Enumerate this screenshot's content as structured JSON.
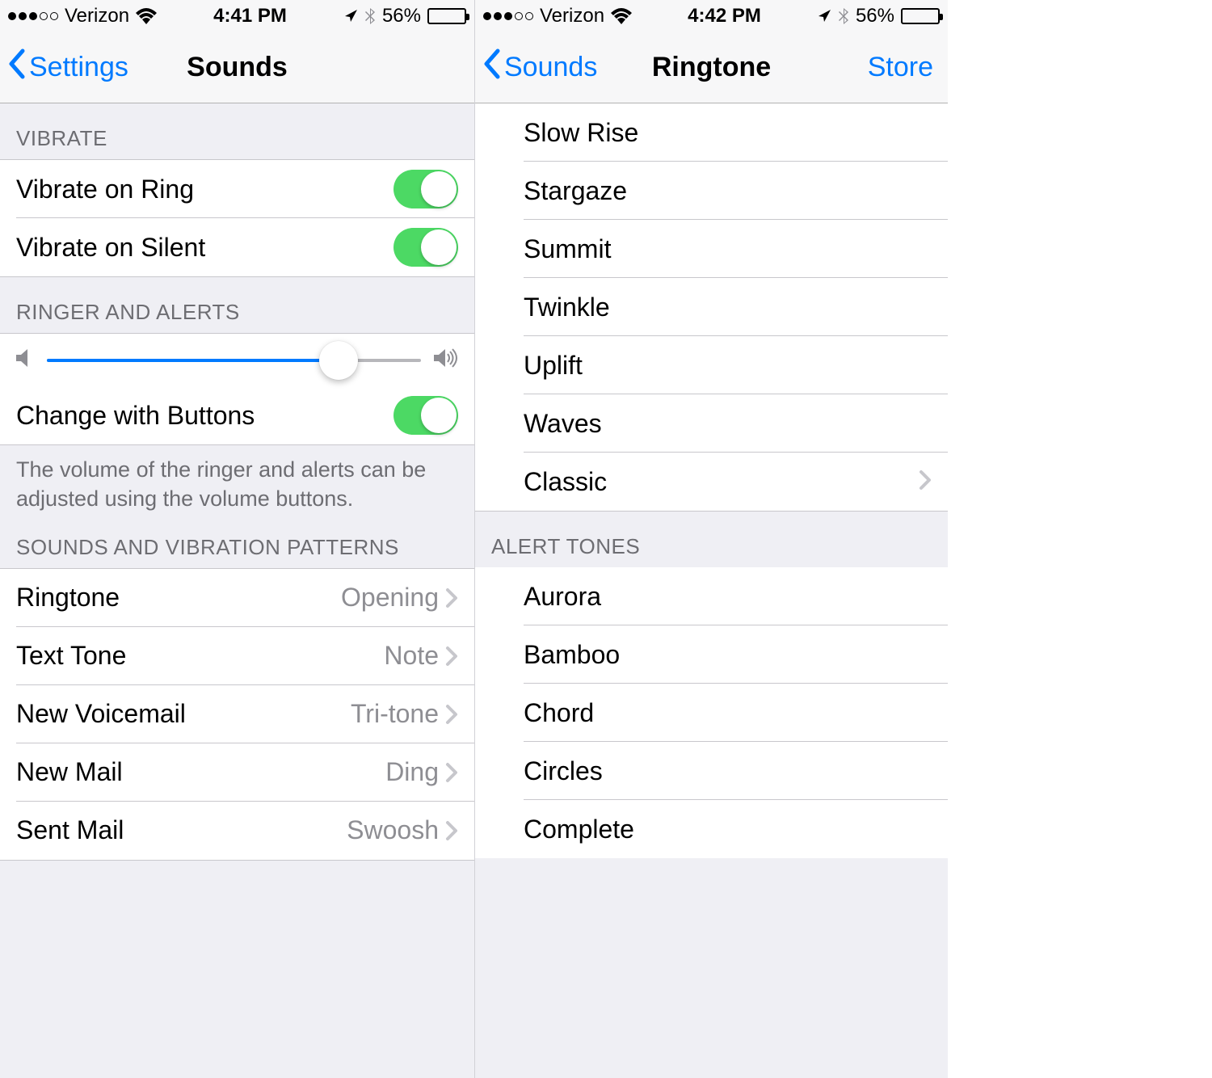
{
  "left": {
    "statusbar": {
      "carrier": "Verizon",
      "time": "4:41 PM",
      "battery_pct": "56%"
    },
    "navbar": {
      "back_label": "Settings",
      "title": "Sounds"
    },
    "sections": {
      "vibrate": {
        "header": "VIBRATE",
        "vibrate_ring": "Vibrate on Ring",
        "vibrate_silent": "Vibrate on Silent"
      },
      "ringer": {
        "header": "RINGER AND ALERTS",
        "change_buttons": "Change with Buttons",
        "footer": "The volume of the ringer and alerts can be adjusted using the volume buttons.",
        "slider_value": 78
      },
      "patterns": {
        "header": "SOUNDS AND VIBRATION PATTERNS",
        "items": [
          {
            "label": "Ringtone",
            "value": "Opening"
          },
          {
            "label": "Text Tone",
            "value": "Note"
          },
          {
            "label": "New Voicemail",
            "value": "Tri-tone"
          },
          {
            "label": "New Mail",
            "value": "Ding"
          },
          {
            "label": "Sent Mail",
            "value": "Swoosh"
          }
        ]
      }
    }
  },
  "right": {
    "statusbar": {
      "carrier": "Verizon",
      "time": "4:42 PM",
      "battery_pct": "56%"
    },
    "navbar": {
      "back_label": "Sounds",
      "title": "Ringtone",
      "right_label": "Store"
    },
    "ringtones": [
      "Slow Rise",
      "Stargaze",
      "Summit",
      "Twinkle",
      "Uplift",
      "Waves"
    ],
    "classic_label": "Classic",
    "alert_header": "ALERT TONES",
    "alert_tones": [
      "Aurora",
      "Bamboo",
      "Chord",
      "Circles",
      "Complete"
    ]
  }
}
